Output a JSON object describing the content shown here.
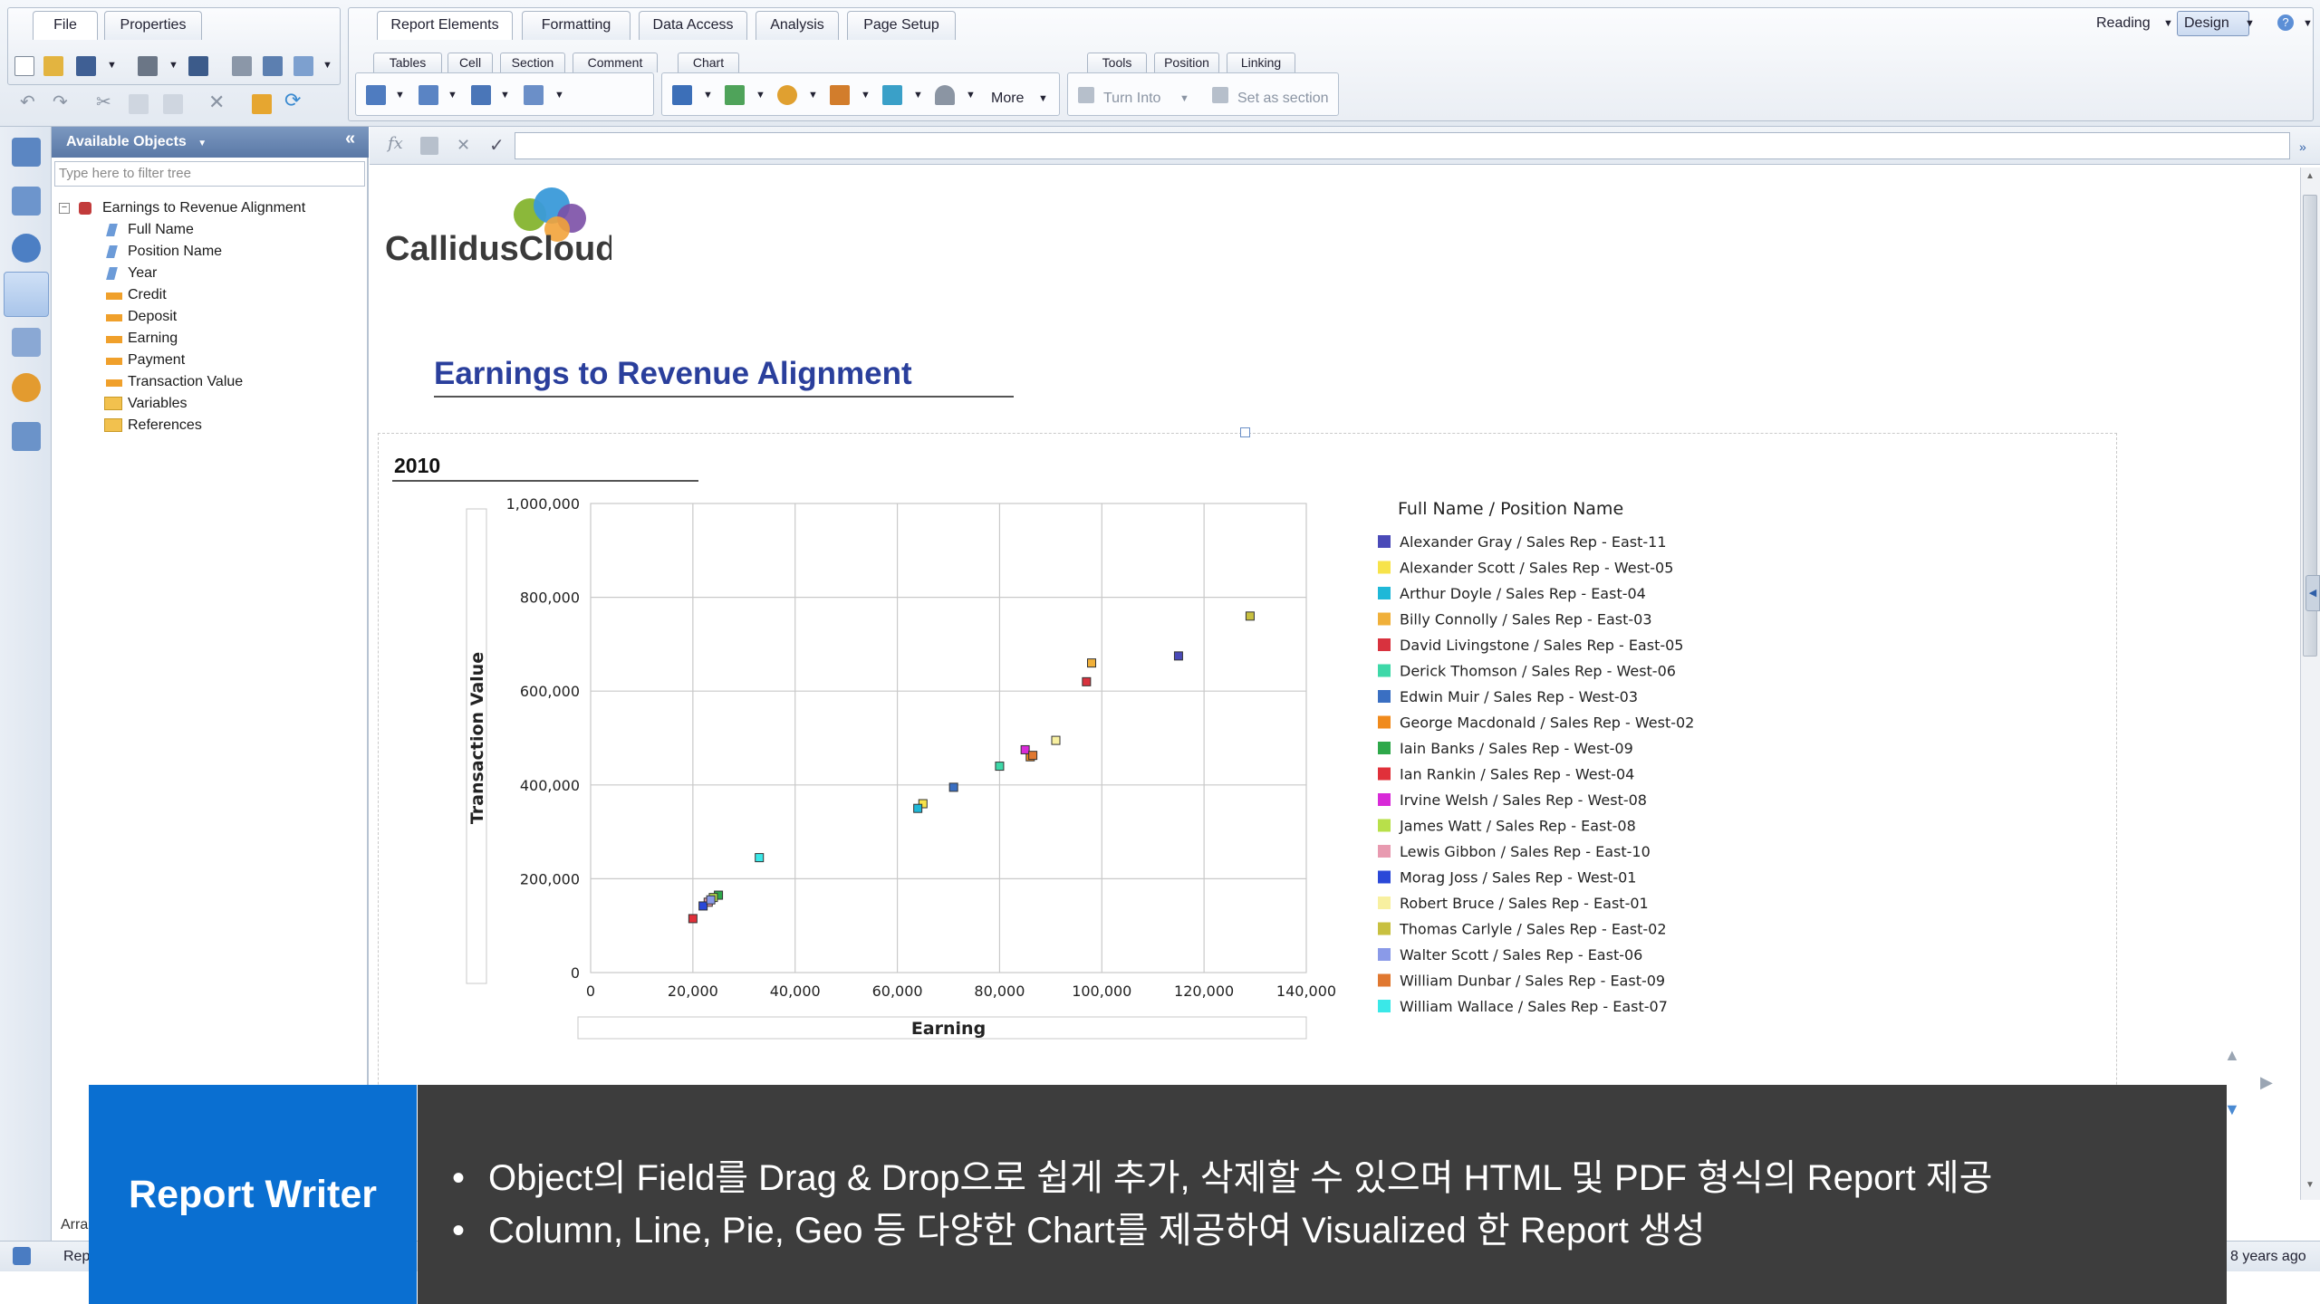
{
  "ribbon": {
    "left_tabs": [
      "File",
      "Properties"
    ],
    "main_tabs": [
      "Report Elements",
      "Formatting",
      "Data Access",
      "Analysis",
      "Page Setup"
    ],
    "sub_tabs": [
      "Tables",
      "Cell",
      "Section",
      "Comment",
      "Chart",
      "Tools",
      "Position",
      "Linking"
    ],
    "more": "More",
    "turn_into": "Turn Into",
    "set_as_section": "Set as section",
    "reading": "Reading",
    "design": "Design"
  },
  "objects": {
    "title": "Available Objects",
    "filter_placeholder": "Type here to filter tree",
    "root": "Earnings to Revenue Alignment",
    "items": [
      "Full Name",
      "Position Name",
      "Year",
      "Credit",
      "Deposit",
      "Earning",
      "Payment",
      "Transaction Value",
      "Variables",
      "References"
    ],
    "bottom_arrange": "Arra"
  },
  "status": {
    "report_tab": "Rep",
    "last_refresh": "8 years ago"
  },
  "report": {
    "logo_text": "CallidusCloud",
    "title": "Earnings to Revenue Alignment",
    "section": "2010"
  },
  "chart_data": {
    "type": "scatter",
    "xlabel": "Earning",
    "ylabel": "Transaction Value",
    "xlim": [
      0,
      140000
    ],
    "ylim": [
      0,
      1000000
    ],
    "x_ticks": [
      "0",
      "20,000",
      "40,000",
      "60,000",
      "80,000",
      "100,000",
      "120,000",
      "140,000"
    ],
    "y_ticks": [
      "0",
      "200,000",
      "400,000",
      "600,000",
      "800,000",
      "1,000,000"
    ],
    "grid": true,
    "legend_title": "Full Name / Position Name",
    "legend_position": "right",
    "series": [
      {
        "name": "Alexander Gray / Sales Rep - East-11",
        "color": "#4a4ab8",
        "x": 115000,
        "y": 675000
      },
      {
        "name": "Alexander Scott / Sales Rep - West-05",
        "color": "#f7e34a",
        "x": 65000,
        "y": 360000
      },
      {
        "name": "Arthur Doyle / Sales Rep - East-04",
        "color": "#1fb8d8",
        "x": 64000,
        "y": 350000
      },
      {
        "name": "Billy Connolly / Sales Rep - East-03",
        "color": "#f0b03a",
        "x": 98000,
        "y": 660000
      },
      {
        "name": "David Livingstone / Sales Rep - East-05",
        "color": "#d8323e",
        "x": 97000,
        "y": 620000
      },
      {
        "name": "Derick Thomson / Sales Rep - West-06",
        "color": "#3ed8a8",
        "x": 80000,
        "y": 440000
      },
      {
        "name": "Edwin Muir / Sales Rep - West-03",
        "color": "#3a6fc2",
        "x": 71000,
        "y": 395000
      },
      {
        "name": "George Macdonald / Sales Rep - West-02",
        "color": "#f08a1c",
        "x": 86000,
        "y": 460000
      },
      {
        "name": "Iain Banks / Sales Rep - West-09",
        "color": "#2ea84a",
        "x": 25000,
        "y": 165000
      },
      {
        "name": "Ian Rankin / Sales Rep - West-04",
        "color": "#e0303a",
        "x": 20000,
        "y": 115000
      },
      {
        "name": "Irvine Welsh / Sales Rep - West-08",
        "color": "#d82ad8",
        "x": 85000,
        "y": 475000
      },
      {
        "name": "James Watt / Sales Rep - East-08",
        "color": "#b8e04a",
        "x": 24000,
        "y": 160000
      },
      {
        "name": "Lewis Gibbon / Sales Rep - East-10",
        "color": "#e89ab0",
        "x": 23000,
        "y": 150000
      },
      {
        "name": "Morag Joss / Sales Rep - West-01",
        "color": "#2a48d8",
        "x": 22000,
        "y": 142000
      },
      {
        "name": "Robert Bruce / Sales Rep - East-01",
        "color": "#f8f0a0",
        "x": 91000,
        "y": 495000
      },
      {
        "name": "Thomas Carlyle / Sales Rep - East-02",
        "color": "#c8c040",
        "x": 129000,
        "y": 760000
      },
      {
        "name": "Walter Scott / Sales Rep - East-06",
        "color": "#8a9ae8",
        "x": 23500,
        "y": 155000
      },
      {
        "name": "William Dunbar / Sales Rep - East-09",
        "color": "#e07830",
        "x": 86500,
        "y": 463000
      },
      {
        "name": "William Wallace / Sales Rep - East-07",
        "color": "#3ae8e8",
        "x": 33000,
        "y": 245000
      }
    ]
  },
  "overlay": {
    "label": "Report Writer",
    "bullets": [
      "Object의 Field를 Drag & Drop으로 쉽게 추가, 삭제할 수 있으며 HTML 및 PDF 형식의 Report 제공",
      "Column, Line, Pie, Geo 등 다양한 Chart를 제공하여 Visualized 한 Report 생성"
    ],
    "colors": {
      "label_bg": "#0a6fd1",
      "text_bg": "#3d3d3d"
    }
  }
}
